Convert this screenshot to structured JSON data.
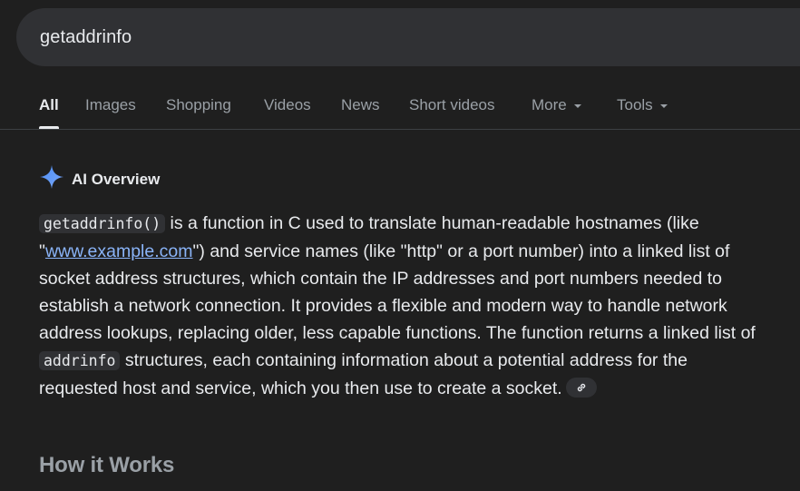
{
  "search": {
    "query": "getaddrinfo"
  },
  "tabs": [
    {
      "label": "All",
      "active": true
    },
    {
      "label": "Images"
    },
    {
      "label": "Shopping"
    },
    {
      "label": "Videos"
    },
    {
      "label": "News"
    },
    {
      "label": "Short videos"
    },
    {
      "label": "More",
      "dropdown": true
    },
    {
      "label": "Tools",
      "dropdown": true
    }
  ],
  "ai_overview": {
    "title": "AI Overview",
    "code_term_1": "getaddrinfo()",
    "text_1": " is a function in C used to translate human-readable hostnames (like \"",
    "link_text": "www.example.com",
    "text_2": "\") and service names (like \"http\" or a port number) into a linked list of socket address structures, which contain the IP addresses and port numbers needed to establish a network connection. It provides a flexible and modern way to handle network address lookups, replacing older, less capable functions. The function returns a linked list of ",
    "code_term_2": "addrinfo",
    "text_3": " structures, each containing information about a potential address for the requested host and service, which you then use to create a socket."
  },
  "section": {
    "heading": "How it Works"
  },
  "colors": {
    "background": "#1f1f1f",
    "search_bar": "#303134",
    "link": "#8ab4f8",
    "muted": "#9aa0a6",
    "sparkle": "#4c8df6"
  },
  "icons": {
    "ai_sparkle": "sparkle-icon",
    "source_link": "link-icon"
  }
}
